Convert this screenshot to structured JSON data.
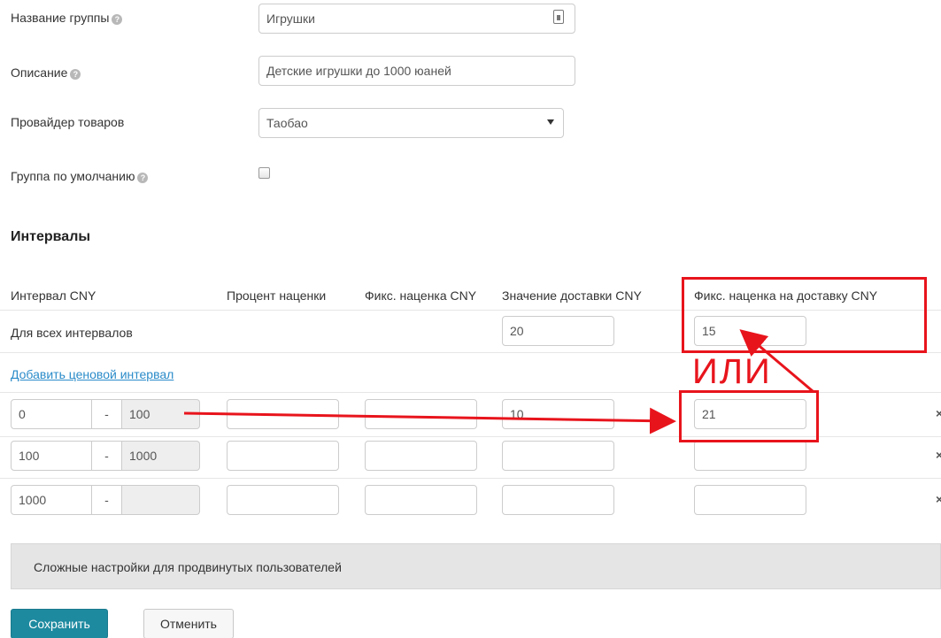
{
  "form": {
    "group_name_label": "Название группы",
    "group_name_value": "Игрушки",
    "description_label": "Описание",
    "description_value": "Детские игрушки до 1000 юаней",
    "provider_label": "Провайдер товаров",
    "provider_selected": "Таобао",
    "default_group_label": "Группа по умолчанию",
    "default_group_checked": false
  },
  "intervals": {
    "title": "Интервалы",
    "headers": [
      "Интервал CNY",
      "Процент наценки",
      "Фикс. наценка CNY",
      "Значение доставки CNY",
      "Фикс. наценка на доставку CNY"
    ],
    "all_label": "Для всех интервалов",
    "all_delivery_value": "20",
    "all_fixed_delivery_markup": "15",
    "add_link": "Добавить ценовой интервал",
    "rows": [
      {
        "from": "0",
        "sep": "-",
        "to": "100",
        "percent": "",
        "fixed": "",
        "delivery": "10",
        "fixed_delivery": "21",
        "delete": "×"
      },
      {
        "from": "100",
        "sep": "-",
        "to": "1000",
        "percent": "",
        "fixed": "",
        "delivery": "",
        "fixed_delivery": "",
        "delete": "×"
      },
      {
        "from": "1000",
        "sep": "-",
        "to": "",
        "percent": "",
        "fixed": "",
        "delivery": "",
        "fixed_delivery": "",
        "delete": "×"
      }
    ]
  },
  "advanced": {
    "label": "Сложные настройки для продвинутых пользователей"
  },
  "buttons": {
    "save": "Сохранить",
    "cancel": "Отменить"
  },
  "annotation": {
    "text": "ИЛИ",
    "color": "#e8141c"
  },
  "colors": {
    "primary": "#1e8aa0",
    "link": "#2a8bc9",
    "annotation": "#e8141c"
  }
}
